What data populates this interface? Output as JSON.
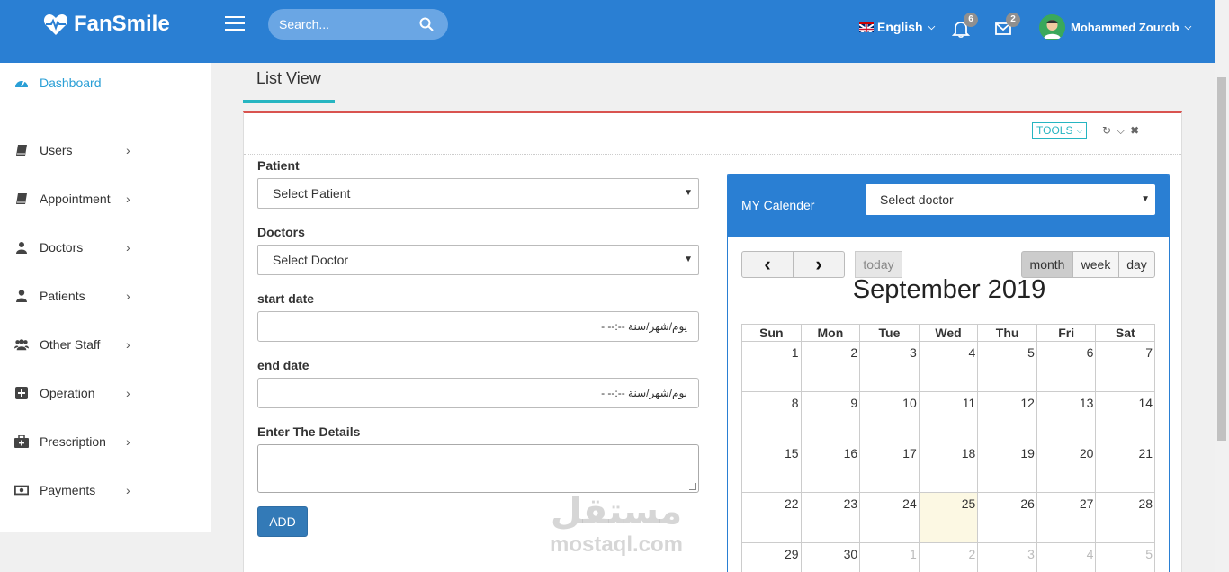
{
  "header": {
    "brand": "FanSmile",
    "search_placeholder": "Search...",
    "language": "English",
    "notifications_count": "6",
    "messages_count": "2",
    "user_name": "Mohammed Zourob"
  },
  "sidebar": {
    "items": [
      {
        "label": "Dashboard",
        "icon": "dashboard-icon"
      },
      {
        "label": "Users",
        "icon": "book-icon"
      },
      {
        "label": "Appointment",
        "icon": "book-icon"
      },
      {
        "label": "Doctors",
        "icon": "doctor-icon"
      },
      {
        "label": "Patients",
        "icon": "user-icon"
      },
      {
        "label": "Other Staff",
        "icon": "users-icon"
      },
      {
        "label": "Operation",
        "icon": "plus-square-icon"
      },
      {
        "label": "Prescription",
        "icon": "medkit-icon"
      },
      {
        "label": "Payments",
        "icon": "money-icon"
      }
    ]
  },
  "tab": {
    "label": "List View"
  },
  "panel": {
    "tools_label": "TOOLS"
  },
  "form": {
    "patient_label": "Patient",
    "patient_value": "Select Patient",
    "doctors_label": "Doctors",
    "doctors_value": "Select Doctor",
    "start_label": "start date",
    "start_value": "- --:-- يوم/شهر/سنة",
    "end_label": "end date",
    "end_value": "- --:-- يوم/شهر/سنة",
    "details_label": "Enter The Details",
    "add_label": "ADD"
  },
  "calendar": {
    "title": "MY Calender",
    "doctor_select": "Select doctor",
    "today_label": "today",
    "views": [
      "month",
      "week",
      "day"
    ],
    "month_title": "September 2019",
    "days_of_week": [
      "Sun",
      "Mon",
      "Tue",
      "Wed",
      "Thu",
      "Fri",
      "Sat"
    ],
    "weeks": [
      [
        "1",
        "2",
        "3",
        "4",
        "5",
        "6",
        "7"
      ],
      [
        "8",
        "9",
        "10",
        "11",
        "12",
        "13",
        "14"
      ],
      [
        "15",
        "16",
        "17",
        "18",
        "19",
        "20",
        "21"
      ],
      [
        "22",
        "23",
        "24",
        "25",
        "26",
        "27",
        "28"
      ],
      [
        "29",
        "30",
        "1",
        "2",
        "3",
        "4",
        "5"
      ]
    ],
    "today_date": "25"
  },
  "watermark": {
    "arabic": "مستقل",
    "latin": "mostaql.com"
  }
}
